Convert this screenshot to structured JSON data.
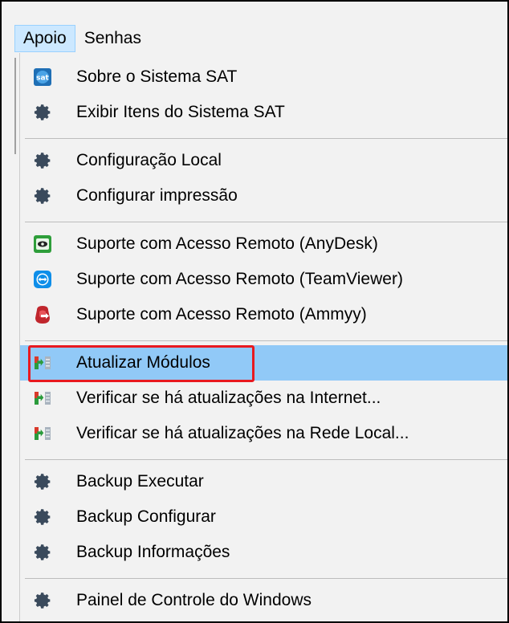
{
  "menubar": {
    "items": [
      {
        "label": "Apoio",
        "active": true
      },
      {
        "label": "Senhas",
        "active": false
      }
    ]
  },
  "dropdown": {
    "items": [
      {
        "label": "Sobre o Sistema SAT",
        "icon": "sat-logo-icon"
      },
      {
        "label": "Exibir Itens do Sistema SAT",
        "icon": "gear-icon"
      },
      {
        "label": "Configuração Local",
        "icon": "gear-icon"
      },
      {
        "label": "Configurar impressão",
        "icon": "gear-icon"
      },
      {
        "label": "Suporte com Acesso Remoto (AnyDesk)",
        "icon": "anydesk-icon"
      },
      {
        "label": "Suporte com Acesso Remoto (TeamViewer)",
        "icon": "teamviewer-icon"
      },
      {
        "label": "Suporte com Acesso Remoto (Ammyy)",
        "icon": "ammyy-icon"
      },
      {
        "label": "Atualizar Módulos",
        "icon": "update-modules-icon",
        "highlighted": true
      },
      {
        "label": "Verificar se há atualizações na Internet...",
        "icon": "update-modules-icon"
      },
      {
        "label": "Verificar se há atualizações na Rede Local...",
        "icon": "update-modules-icon"
      },
      {
        "label": "Backup Executar",
        "icon": "gear-icon"
      },
      {
        "label": "Backup Configurar",
        "icon": "gear-icon"
      },
      {
        "label": "Backup Informações",
        "icon": "gear-icon"
      },
      {
        "label": "Painel de Controle do Windows",
        "icon": "gear-icon"
      }
    ]
  },
  "colors": {
    "highlight": "#91c9f7",
    "annotation_box": "#e8191f",
    "menu_active": "#cce8ff"
  }
}
